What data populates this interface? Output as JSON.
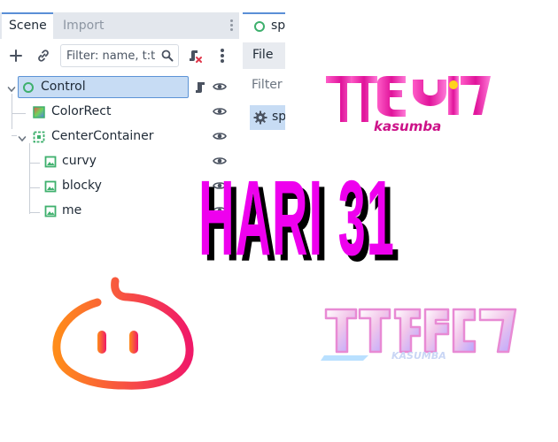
{
  "scene_dock": {
    "tabs": [
      {
        "label": "Scene",
        "active": true
      },
      {
        "label": "Import",
        "active": false
      }
    ],
    "toolbar": {
      "add_icon": "plus-icon",
      "link_icon": "link-icon",
      "filter_placeholder": "Filter: name, t:t",
      "filter_icon": "search-icon",
      "script_icon": "script-remove-icon",
      "menu_icon": "kebab-menu-icon"
    },
    "tree": [
      {
        "label": "Control",
        "icon": "control-node-icon",
        "selected": true,
        "has_script": true
      },
      {
        "label": "ColorRect",
        "icon": "color-rect-icon"
      },
      {
        "label": "CenterContainer",
        "icon": "center-container-icon",
        "expanded": true
      },
      {
        "label": "curvy",
        "icon": "texture-rect-icon"
      },
      {
        "label": "blocky",
        "icon": "texture-rect-icon"
      },
      {
        "label": "me",
        "icon": "texture-rect-icon"
      }
    ]
  },
  "right_dock": {
    "tab_label": "spl",
    "file_menu": "File",
    "filter_text": "Filter S",
    "selected_item": "sp"
  },
  "artwork": {
    "headline": "HARI 31",
    "logo1_subtitle": "kasumba",
    "logo2_subtitle": "KASUMBA"
  },
  "colors": {
    "accent": "#5a8fd6",
    "selection": "#c7dcf4",
    "headline": "#ee00ee",
    "control_icon": "#3eb06d",
    "texture_icon": "#3eb06d"
  }
}
